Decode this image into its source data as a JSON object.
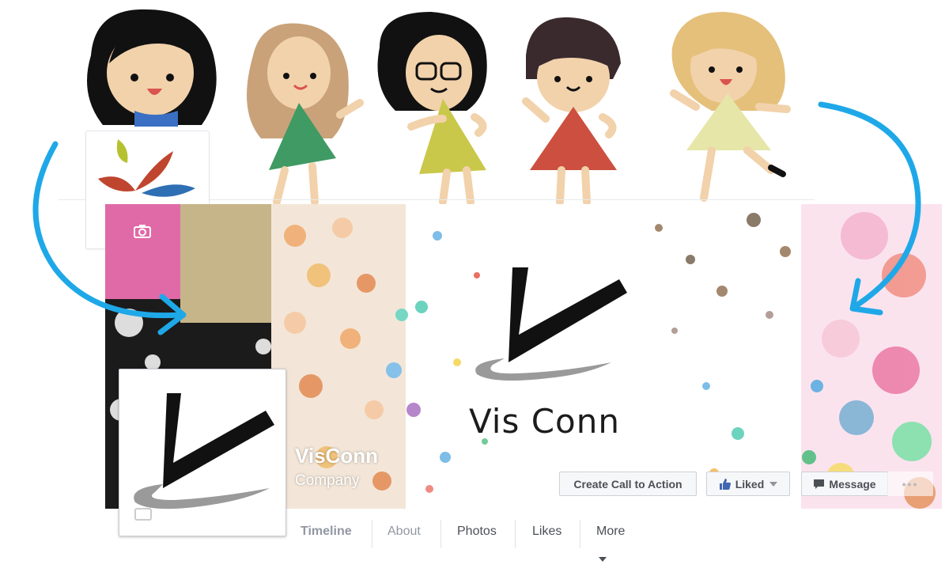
{
  "cover": {
    "brand_name": "Vis Conn",
    "page_title": "VisConn",
    "page_category": "Company"
  },
  "actions": {
    "cta_label": "Create Call to Action",
    "liked_label": "Liked",
    "message_label": "Message",
    "more_label": "•••"
  },
  "tabs": [
    {
      "label": "Timeline"
    },
    {
      "label": "About"
    },
    {
      "label": "Photos"
    },
    {
      "label": "Likes"
    },
    {
      "label": "More"
    }
  ],
  "icons": [
    "camera-icon",
    "thumbs-up-icon",
    "chevron-down-icon",
    "message-icon",
    "arrow-icon"
  ],
  "colors": {
    "arrow": "#1fa8e8",
    "facebook_blue": "#4267b2",
    "button_text": "#4b4f56"
  }
}
